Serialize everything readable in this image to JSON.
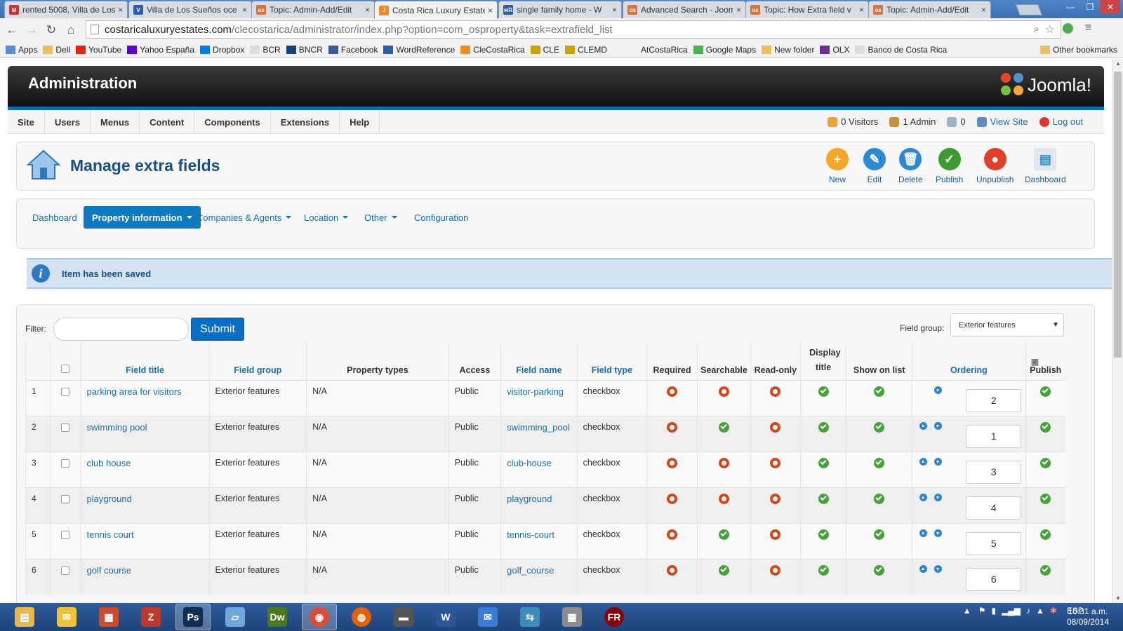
{
  "browser": {
    "tabs": [
      {
        "title": "rented 5008, Villa de Los",
        "fav": "M",
        "color": "#c33"
      },
      {
        "title": "Villa de Los Sueños oce",
        "fav": "V",
        "color": "#2a5db0"
      },
      {
        "title": "Topic: Admin-Add/Edit",
        "fav": "os",
        "color": "#d9733b"
      },
      {
        "title": "Costa Rica Luxury Estate",
        "fav": "J",
        "color": "#f08a24"
      },
      {
        "title": "single family home - W",
        "fav": "wR",
        "color": "#2c5fa8"
      },
      {
        "title": "Advanced Search - Joom",
        "fav": "os",
        "color": "#d9733b"
      },
      {
        "title": "Topic: How Extra field v",
        "fav": "os",
        "color": "#d9733b"
      },
      {
        "title": "Topic: Admin-Add/Edit",
        "fav": "os",
        "color": "#d9733b"
      }
    ],
    "active_tab": 3,
    "url_host": "costaricaluxuryestates.com",
    "url_path": "/clecostarica/administrator/index.php?option=com_osproperty&task=extrafield_list",
    "bookmarks": [
      {
        "label": "Apps",
        "icon": "apps-icon"
      },
      {
        "label": "Dell",
        "icon": "folder-icon"
      },
      {
        "label": "YouTube",
        "icon": "youtube-icon"
      },
      {
        "label": "Yahoo España",
        "icon": "yahoo-icon"
      },
      {
        "label": "Dropbox",
        "icon": "dropbox-icon"
      },
      {
        "label": "BCR",
        "icon": "page-icon"
      },
      {
        "label": "BNCR",
        "icon": "bn-icon"
      },
      {
        "label": "Facebook",
        "icon": "facebook-icon"
      },
      {
        "label": "WordReference",
        "icon": "wr-icon"
      },
      {
        "label": "CleCostaRica",
        "icon": "joomla-icon"
      },
      {
        "label": "CLE",
        "icon": "cle-icon"
      },
      {
        "label": "CLEMD",
        "icon": "cle-icon"
      },
      {
        "label": "AtCostaRica",
        "icon": "blank-icon"
      },
      {
        "label": "Google Maps",
        "icon": "maps-icon"
      },
      {
        "label": "New folder",
        "icon": "folder-icon"
      },
      {
        "label": "OLX",
        "icon": "olx-icon"
      },
      {
        "label": "Banco de Costa Rica",
        "icon": "page-icon"
      }
    ],
    "other_bookmarks": "Other bookmarks"
  },
  "admin": {
    "title": "Administration",
    "brand": "Joomla!",
    "menu": [
      "Site",
      "Users",
      "Menus",
      "Content",
      "Components",
      "Extensions",
      "Help"
    ],
    "status": {
      "visitors": "0 Visitors",
      "admins": "1 Admin",
      "messages": "0",
      "view_site": "View Site",
      "logout": "Log out"
    }
  },
  "toolbar": {
    "page_title": "Manage extra fields",
    "buttons": [
      {
        "label": "New",
        "color": "#f5a623",
        "glyph": "+"
      },
      {
        "label": "Edit",
        "color": "#2a8ad4",
        "glyph": "✎"
      },
      {
        "label": "Delete",
        "color": "#2a8ad4",
        "glyph": "🗑"
      },
      {
        "label": "Publish",
        "color": "#3d9a2e",
        "glyph": "✓"
      },
      {
        "label": "Unpublish",
        "color": "#e0402a",
        "glyph": "●"
      },
      {
        "label": "Dashboard",
        "color": "#dfe6ee",
        "glyph": "▤"
      }
    ]
  },
  "subnav": {
    "items": [
      "Dashboard",
      "Property information",
      "Companies & Agents",
      "Location",
      "Other",
      "Configuration"
    ]
  },
  "alert": {
    "message": "Item has been saved"
  },
  "list": {
    "filter_label": "Filter:",
    "filter_value": "",
    "submit_label": "Submit",
    "field_group_label": "Field group:",
    "field_group_value": "Exterior features",
    "columns": [
      "",
      "",
      "Field title",
      "Field group",
      "Property types",
      "Access",
      "Field name",
      "Field type",
      "Required",
      "Searchable",
      "Read-only",
      "Display title",
      "Show on list",
      "Ordering",
      "Publish"
    ],
    "rows": [
      {
        "num": "1",
        "title": "parking area for visitors",
        "group": "Exterior features",
        "types": "N/A",
        "access": "Public",
        "name": "visitor-parking",
        "type": "checkbox",
        "required": false,
        "searchable": false,
        "readonly": false,
        "display_title": true,
        "show_on_list": true,
        "up": false,
        "down": true,
        "order": "2",
        "publish": true
      },
      {
        "num": "2",
        "title": "swimming pool",
        "group": "Exterior features",
        "types": "N/A",
        "access": "Public",
        "name": "swimming_pool",
        "type": "checkbox",
        "required": false,
        "searchable": true,
        "readonly": false,
        "display_title": true,
        "show_on_list": true,
        "up": true,
        "down": true,
        "order": "1",
        "publish": true
      },
      {
        "num": "3",
        "title": "club house",
        "group": "Exterior features",
        "types": "N/A",
        "access": "Public",
        "name": "club-house",
        "type": "checkbox",
        "required": false,
        "searchable": false,
        "readonly": false,
        "display_title": true,
        "show_on_list": true,
        "up": true,
        "down": true,
        "order": "3",
        "publish": true
      },
      {
        "num": "4",
        "title": "playground",
        "group": "Exterior features",
        "types": "N/A",
        "access": "Public",
        "name": "playground",
        "type": "checkbox",
        "required": false,
        "searchable": false,
        "readonly": false,
        "display_title": true,
        "show_on_list": true,
        "up": true,
        "down": true,
        "order": "4",
        "publish": true
      },
      {
        "num": "5",
        "title": "tennis court",
        "group": "Exterior features",
        "types": "N/A",
        "access": "Public",
        "name": "tennis-court",
        "type": "checkbox",
        "required": false,
        "searchable": true,
        "readonly": false,
        "display_title": true,
        "show_on_list": true,
        "up": true,
        "down": true,
        "order": "5",
        "publish": true
      },
      {
        "num": "6",
        "title": "golf course",
        "group": "Exterior features",
        "types": "N/A",
        "access": "Public",
        "name": "golf_course",
        "type": "checkbox",
        "required": false,
        "searchable": true,
        "readonly": false,
        "display_title": true,
        "show_on_list": true,
        "up": true,
        "down": true,
        "order": "6",
        "publish": true
      }
    ]
  },
  "taskbar": {
    "apps": [
      {
        "name": "explorer-icon",
        "color": "#e8b84a",
        "glyph": "▤"
      },
      {
        "name": "outlook-icon",
        "color": "#f1c232",
        "glyph": "✉"
      },
      {
        "name": "office-icon",
        "color": "#d04a2a",
        "glyph": "▦"
      },
      {
        "name": "filezilla-icon",
        "color": "#c0392b",
        "glyph": "Z"
      },
      {
        "name": "photoshop-icon",
        "color": "#0f2d4f",
        "glyph": "Ps"
      },
      {
        "name": "notes-icon",
        "color": "#6fa8dc",
        "glyph": "▱"
      },
      {
        "name": "dreamweaver-icon",
        "color": "#4c7a1a",
        "glyph": "Dw"
      },
      {
        "name": "chrome-icon",
        "color": "#dd4b39",
        "glyph": "◉"
      },
      {
        "name": "firefox-icon",
        "color": "#e66000",
        "glyph": "◍"
      },
      {
        "name": "scanner-icon",
        "color": "#555",
        "glyph": "▬"
      },
      {
        "name": "word-icon",
        "color": "#2b579a",
        "glyph": "W"
      },
      {
        "name": "thunderbird-icon",
        "color": "#3a7bd5",
        "glyph": "✉"
      },
      {
        "name": "network-icon",
        "color": "#3c8dbc",
        "glyph": "⇆"
      },
      {
        "name": "calculator-icon",
        "color": "#8c8c8c",
        "glyph": "▦"
      },
      {
        "name": "fr-icon",
        "color": "#8b0000",
        "glyph": "FR"
      }
    ],
    "lang": "ESP",
    "time": "10:31 a.m.",
    "date": "08/09/2014"
  }
}
